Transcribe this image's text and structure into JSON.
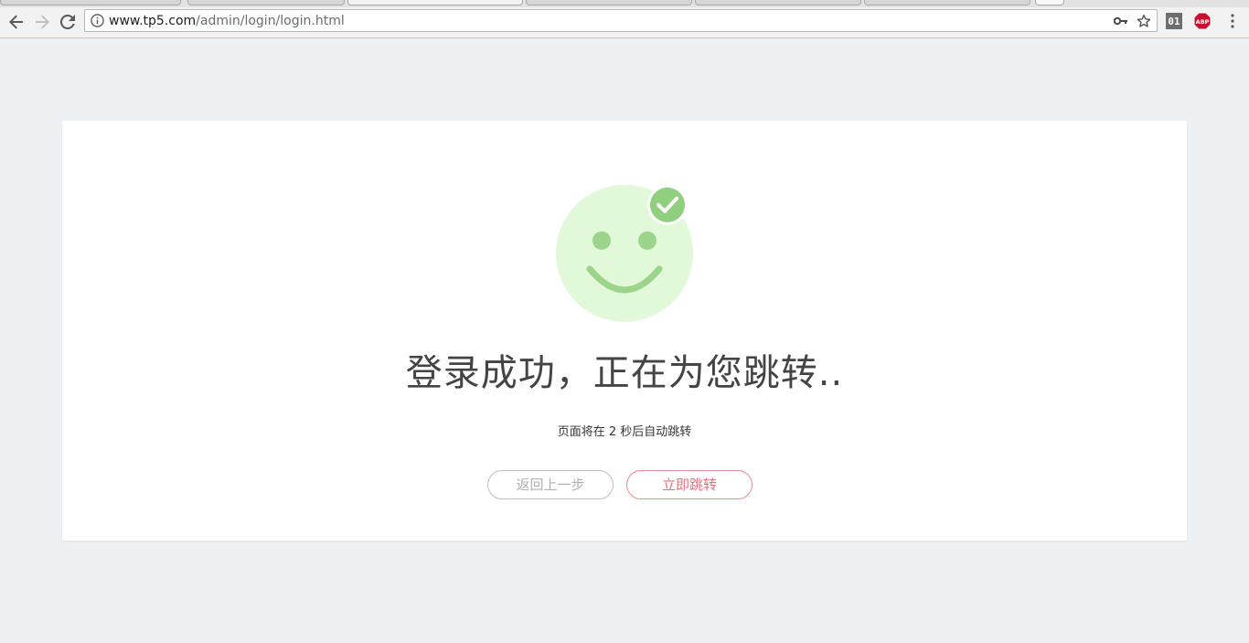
{
  "browser": {
    "url_domain": "www.tp5.com",
    "url_path": "/admin/login/login.html",
    "extensions": {
      "counter_label": "01",
      "adblock_label": "ABP"
    }
  },
  "page": {
    "headline": "登录成功，正在为您跳转..",
    "countdown_prefix": "页面将在",
    "countdown_seconds": "2",
    "countdown_suffix": "秒后自动跳转",
    "back_label": "返回上一步",
    "jump_label": "立即跳转"
  },
  "colors": {
    "page_bg": "#ecf0f3",
    "smiley_face": "#e1f9d9",
    "smiley_features": "#9bd48a",
    "check_badge": "#8fcf7e",
    "jump_button": "#ef6f7c"
  },
  "icons": {
    "success": "smiley-face-icon",
    "badge": "check-badge-icon"
  }
}
